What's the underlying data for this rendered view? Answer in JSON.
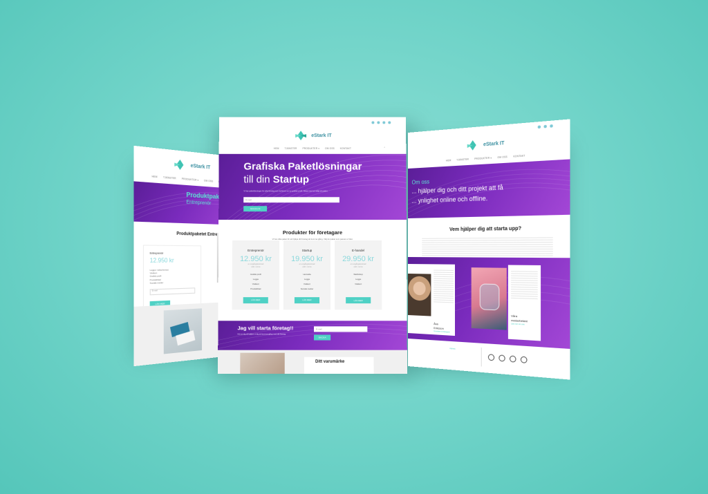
{
  "brand": {
    "name": "eStark IT"
  },
  "nav_items": [
    "HEM",
    "TJÄNSTER",
    "PRODUKTER ▾",
    "OM OSS",
    "KONTAKT"
  ],
  "center": {
    "hero_line1": "Grafiska Paketlösningar",
    "hero_line2_prefix": "till din",
    "hero_line2_bold": "Startup",
    "hero_text": "Vi har paketlösningar för alla företag som behöver en ny grafisk profil. Börja med att välja ett paket.",
    "hero_input_placeholder": "E-mail",
    "hero_button": "SKICKA IN",
    "products_title": "Produkter för företagare",
    "products_text": "Vi har olika paket för att hjälpa ditt företag att komma igång. Välj det paket som passar er bäst.",
    "cards": [
      {
        "name": "Entreprenör",
        "price": "12.950 kr",
        "note1": "en engångskostnad",
        "note2": "exkl. moms",
        "features": [
          "Grafisk profil",
          "Logga",
          "Visitkort",
          "Produktblad"
        ],
        "button": "LÄS MER"
      },
      {
        "name": "Startup",
        "price": "19.950 kr",
        "note1": "en engångskostnad",
        "note2": "exkl. moms",
        "features": [
          "Hemsida",
          "Logga",
          "Visitkort",
          "Sociala medier"
        ],
        "button": "LÄS MER"
      },
      {
        "name": "E-handel",
        "price": "29.950 kr",
        "note1": "en engångskostnad",
        "note2": "exkl. moms",
        "features": [
          "Webbshop",
          "Logga",
          "Visitkort"
        ],
        "button": "LÄS MER"
      }
    ],
    "cta_title": "Jag vill starta företag!!",
    "cta_text": "Hör av dig så hjälper vi dig att komma igång med ditt företag.",
    "cta_input_placeholder": "E-mail",
    "cta_button": "SKICKA",
    "brand_section_title": "Ditt varumärke"
  },
  "left": {
    "hero_title": "Produktpaket",
    "hero_subtitle": "Entreprenör",
    "section_title": "Produktpaketet Entreprenör",
    "card_name": "Entreprenör",
    "card_price": "12.950 kr",
    "card_button": "LÄS MER",
    "card_input_placeholder": "E-mail",
    "card_features": [
      "Logga i vektorformat",
      "Visitkort",
      "Grafisk profil",
      "Produktblad",
      "Sociala medier"
    ]
  },
  "right": {
    "hero_title": "Om oss",
    "hero_line1": "... hjälper dig och ditt projekt att få",
    "hero_line2": "... ynlighet online och offline.",
    "section_title": "Vem hjälper dig att starta upp?",
    "link_text": "Läs mer om hur vi kan hjälpa dig",
    "person_name": "Åsa",
    "person_surname": "Eriksson",
    "person_role": "Grundare & Designer",
    "team_title1": "Våra",
    "team_title2": "medarbetare",
    "team_link": "Läs mer om oss",
    "footer_label": "Adress"
  },
  "colors": {
    "accent": "#4fd1c5",
    "purple_dark": "#5b1e98",
    "purple_light": "#a347d6",
    "background": "#6fd3c8"
  }
}
